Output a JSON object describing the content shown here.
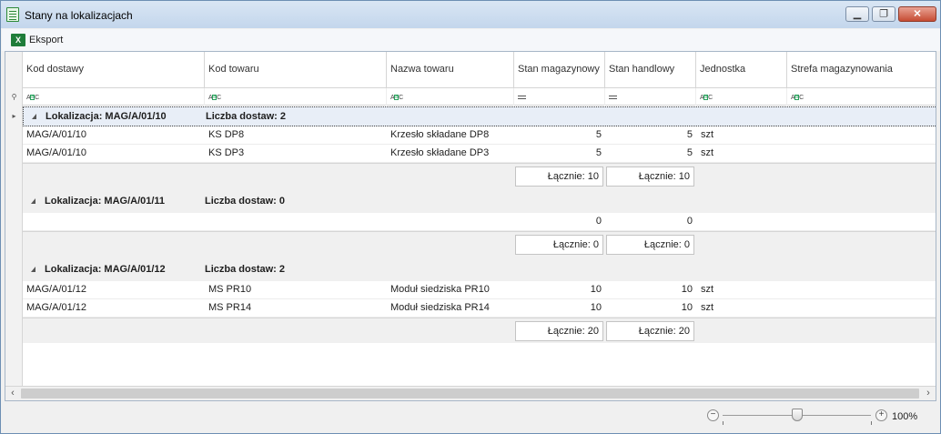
{
  "window": {
    "title": "Stany na lokalizacjach"
  },
  "toolbar": {
    "export_label": "Eksport",
    "export_icon": "excel-icon"
  },
  "columns": [
    "Kod dostawy",
    "Kod towaru",
    "Nazwa towaru",
    "Stan magazynowy",
    "Stan handlowy",
    "Jednostka",
    "Strefa magazynowania"
  ],
  "groups": [
    {
      "location": "Lokalizacja: MAG/A/01/10",
      "count": "Liczba dostaw: 2",
      "rows": [
        {
          "kod_dostawy": "MAG/A/01/10",
          "kod_towaru": "KS DP8",
          "nazwa": "Krzesło składane DP8",
          "stan_mag": "5",
          "stan_handl": "5",
          "jednostka": "szt"
        },
        {
          "kod_dostawy": "MAG/A/01/10",
          "kod_towaru": "KS DP3",
          "nazwa": "Krzesło składane DP3",
          "stan_mag": "5",
          "stan_handl": "5",
          "jednostka": "szt"
        }
      ],
      "sum_mag": "Łącznie: 10",
      "sum_handl": "Łącznie: 10"
    },
    {
      "location": "Lokalizacja: MAG/A/01/11",
      "count": "Liczba dostaw: 0",
      "rows": [
        {
          "kod_dostawy": "",
          "kod_towaru": "",
          "nazwa": "",
          "stan_mag": "0",
          "stan_handl": "0",
          "jednostka": ""
        }
      ],
      "sum_mag": "Łącznie: 0",
      "sum_handl": "Łącznie: 0"
    },
    {
      "location": "Lokalizacja: MAG/A/01/12",
      "count": "Liczba dostaw: 2",
      "rows": [
        {
          "kod_dostawy": "MAG/A/01/12",
          "kod_towaru": "MS PR10",
          "nazwa": "Moduł siedziska PR10",
          "stan_mag": "10",
          "stan_handl": "10",
          "jednostka": "szt"
        },
        {
          "kod_dostawy": "MAG/A/01/12",
          "kod_towaru": "MS PR14",
          "nazwa": "Moduł siedziska PR14",
          "stan_mag": "10",
          "stan_handl": "10",
          "jednostka": "szt"
        }
      ],
      "sum_mag": "Łącznie: 20",
      "sum_handl": "Łącznie: 20"
    }
  ],
  "zoom": {
    "label": "100%",
    "value_percent": 100
  },
  "colors": {
    "accent": "#1f7d3a",
    "group_bg": "#f0f0f0",
    "titlebar": "#c3d6ec"
  }
}
